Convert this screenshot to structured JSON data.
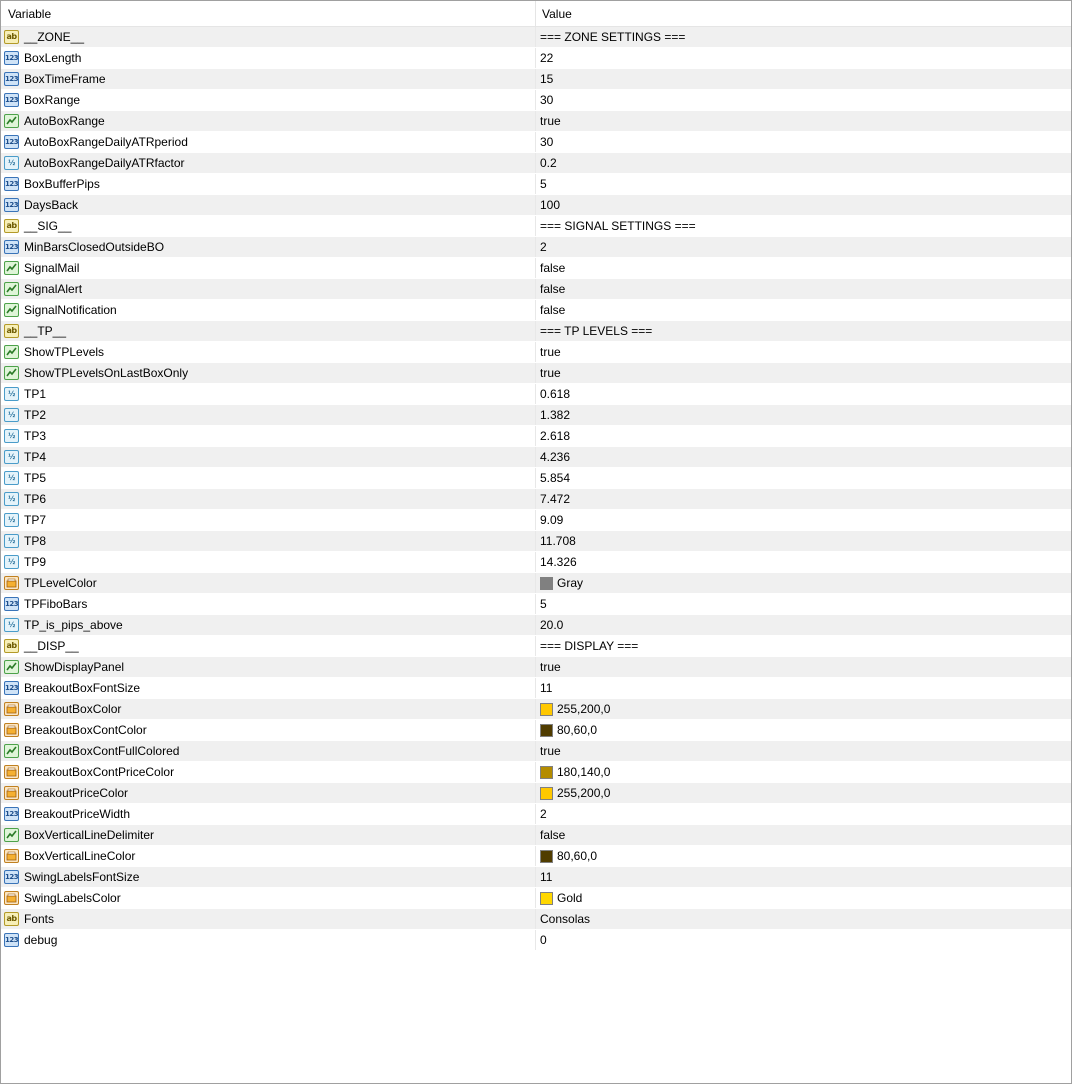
{
  "header": {
    "variable": "Variable",
    "value": "Value"
  },
  "rows": [
    {
      "type": "str",
      "name": "__ZONE__",
      "value": "=== ZONE SETTINGS ==="
    },
    {
      "type": "int",
      "name": "BoxLength",
      "value": "22"
    },
    {
      "type": "int",
      "name": "BoxTimeFrame",
      "value": "15"
    },
    {
      "type": "int",
      "name": "BoxRange",
      "value": "30"
    },
    {
      "type": "bool",
      "name": "AutoBoxRange",
      "value": "true"
    },
    {
      "type": "int",
      "name": "AutoBoxRangeDailyATRperiod",
      "value": "30"
    },
    {
      "type": "dbl",
      "name": "AutoBoxRangeDailyATRfactor",
      "value": "0.2"
    },
    {
      "type": "int",
      "name": "BoxBufferPips",
      "value": "5"
    },
    {
      "type": "int",
      "name": "DaysBack",
      "value": "100"
    },
    {
      "type": "str",
      "name": "__SIG__",
      "value": "=== SIGNAL SETTINGS ==="
    },
    {
      "type": "int",
      "name": "MinBarsClosedOutsideBO",
      "value": "2"
    },
    {
      "type": "bool",
      "name": "SignalMail",
      "value": "false"
    },
    {
      "type": "bool",
      "name": "SignalAlert",
      "value": "false"
    },
    {
      "type": "bool",
      "name": "SignalNotification",
      "value": "false"
    },
    {
      "type": "str",
      "name": "__TP__",
      "value": "=== TP LEVELS ==="
    },
    {
      "type": "bool",
      "name": "ShowTPLevels",
      "value": "true"
    },
    {
      "type": "bool",
      "name": "ShowTPLevelsOnLastBoxOnly",
      "value": "true"
    },
    {
      "type": "dbl",
      "name": "TP1",
      "value": "0.618"
    },
    {
      "type": "dbl",
      "name": "TP2",
      "value": "1.382"
    },
    {
      "type": "dbl",
      "name": "TP3",
      "value": "2.618"
    },
    {
      "type": "dbl",
      "name": "TP4",
      "value": "4.236"
    },
    {
      "type": "dbl",
      "name": "TP5",
      "value": "5.854"
    },
    {
      "type": "dbl",
      "name": "TP6",
      "value": "7.472"
    },
    {
      "type": "dbl",
      "name": "TP7",
      "value": "9.09"
    },
    {
      "type": "dbl",
      "name": "TP8",
      "value": "11.708"
    },
    {
      "type": "dbl",
      "name": "TP9",
      "value": "14.326"
    },
    {
      "type": "col",
      "name": "TPLevelColor",
      "value": "Gray",
      "swatch": "#808080"
    },
    {
      "type": "int",
      "name": "TPFiboBars",
      "value": "5"
    },
    {
      "type": "dbl",
      "name": "TP_is_pips_above",
      "value": "20.0"
    },
    {
      "type": "str",
      "name": "__DISP__",
      "value": "=== DISPLAY ==="
    },
    {
      "type": "bool",
      "name": "ShowDisplayPanel",
      "value": "true"
    },
    {
      "type": "int",
      "name": "BreakoutBoxFontSize",
      "value": "11"
    },
    {
      "type": "col",
      "name": "BreakoutBoxColor",
      "value": "255,200,0",
      "swatch": "#ffc800"
    },
    {
      "type": "col",
      "name": "BreakoutBoxContColor",
      "value": "80,60,0",
      "swatch": "#503c00"
    },
    {
      "type": "bool",
      "name": "BreakoutBoxContFullColored",
      "value": "true"
    },
    {
      "type": "col",
      "name": "BreakoutBoxContPriceColor",
      "value": "180,140,0",
      "swatch": "#b48c00"
    },
    {
      "type": "col",
      "name": "BreakoutPriceColor",
      "value": "255,200,0",
      "swatch": "#ffc800"
    },
    {
      "type": "int",
      "name": "BreakoutPriceWidth",
      "value": "2"
    },
    {
      "type": "bool",
      "name": "BoxVerticalLineDelimiter",
      "value": "false"
    },
    {
      "type": "col",
      "name": "BoxVerticalLineColor",
      "value": "80,60,0",
      "swatch": "#503c00"
    },
    {
      "type": "int",
      "name": "SwingLabelsFontSize",
      "value": "11"
    },
    {
      "type": "col",
      "name": "SwingLabelsColor",
      "value": "Gold",
      "swatch": "#ffd700"
    },
    {
      "type": "str",
      "name": "Fonts",
      "value": "Consolas"
    },
    {
      "type": "int",
      "name": "debug",
      "value": "0"
    }
  ],
  "icons": {
    "int": {
      "name": "integer-type-icon",
      "glyph": "123"
    },
    "dbl": {
      "name": "double-type-icon",
      "glyph": "½"
    },
    "str": {
      "name": "string-type-icon",
      "glyph": "ab"
    },
    "bool": {
      "name": "boolean-type-icon",
      "glyph": ""
    },
    "col": {
      "name": "color-type-icon",
      "glyph": ""
    }
  }
}
